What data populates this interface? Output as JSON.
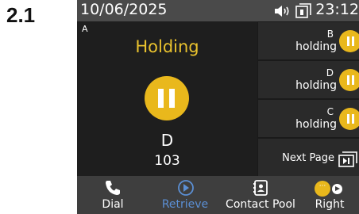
{
  "step_label": "2.1",
  "status_bar": {
    "date": "10/06/2025",
    "time": "23:12"
  },
  "main_call": {
    "line_letter": "A",
    "state": "Holding",
    "caller_name": "D",
    "caller_number": "103"
  },
  "line_keys": [
    {
      "letter": "B",
      "status": "holding"
    },
    {
      "letter": "D",
      "status": "holding"
    },
    {
      "letter": "C",
      "status": "holding"
    }
  ],
  "next_page_label": "Next Page",
  "softkeys": [
    {
      "label": "Dial"
    },
    {
      "label": "Retrieve"
    },
    {
      "label": "Contact Pool"
    },
    {
      "label": "Right",
      "dot_text": "···"
    }
  ],
  "colors": {
    "hold_yellow": "#e9b81c",
    "holding_text": "#e9c22e",
    "retrieve_blue": "#5b8fd4",
    "status_bar_bg": "#4a4a4a"
  }
}
